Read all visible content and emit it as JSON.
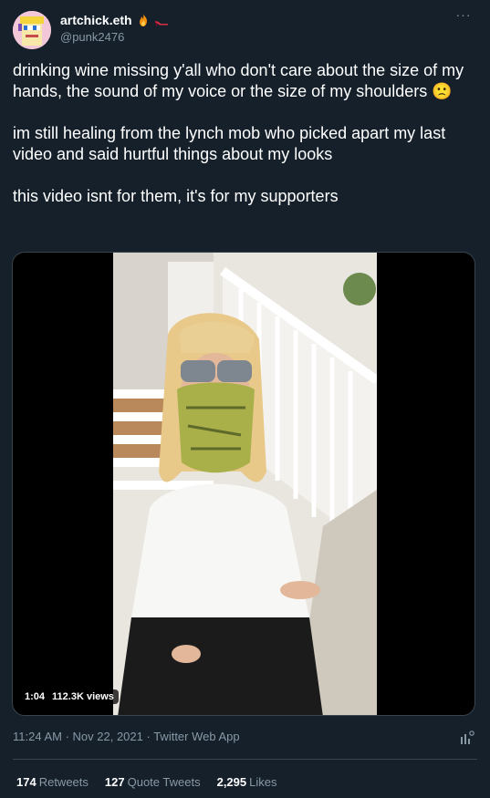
{
  "tweet": {
    "author": {
      "display_name": "artchick.eth",
      "handle": "@punk2476",
      "badges": [
        "fire-emoji",
        "high-heel-emoji"
      ]
    },
    "more_label": "···",
    "paragraphs": [
      "drinking wine missing y'all who don't care about the size of my hands, the sound of my voice or the size of my shoulders 🙁",
      "im still healing from the lynch mob who picked apart my last video and said hurtful things about my looks",
      "this video isnt for them, it's for my supporters"
    ],
    "media": {
      "duration": "1:04",
      "views": "112.3K views"
    },
    "meta": {
      "time": "11:24 AM",
      "separator": " · ",
      "date": "Nov 22, 2021",
      "source": "Twitter Web App"
    },
    "stats": {
      "retweets_count": "174",
      "retweets_label": "Retweets",
      "quotes_count": "127",
      "quotes_label": "Quote Tweets",
      "likes_count": "2,295",
      "likes_label": "Likes"
    }
  },
  "colors": {
    "background": "#15202b",
    "secondary_text": "#8899a6",
    "divider": "#38444d"
  }
}
